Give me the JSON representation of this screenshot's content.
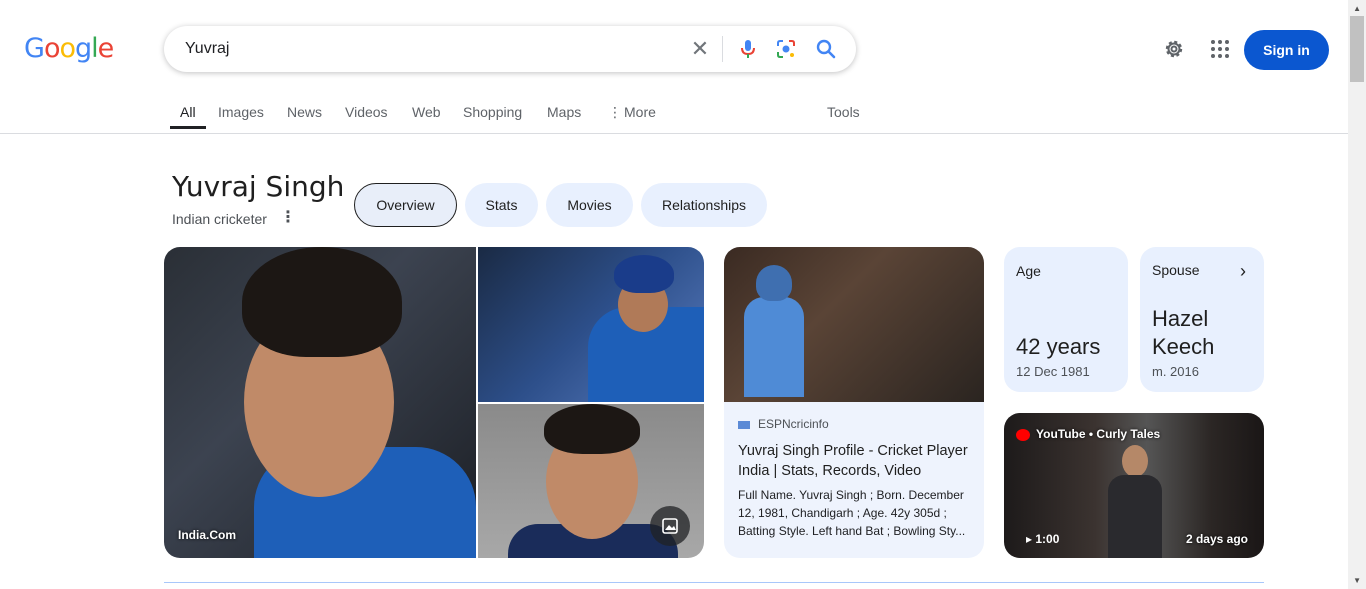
{
  "header": {
    "logo": [
      "G",
      "o",
      "o",
      "g",
      "l",
      "e"
    ],
    "logo_colors": [
      "#4285f4",
      "#ea4335",
      "#fbbc05",
      "#4285f4",
      "#34a853",
      "#ea4335"
    ],
    "search_value": "Yuvraj",
    "sign_in": "Sign in"
  },
  "nav": {
    "tabs": [
      "All",
      "Images",
      "News",
      "Videos",
      "Web",
      "Shopping",
      "Maps",
      "More"
    ],
    "tools": "Tools"
  },
  "entity": {
    "title": "Yuvraj Singh",
    "subtitle": "Indian cricketer",
    "chips": [
      "Overview",
      "Stats",
      "Movies",
      "Relationships"
    ]
  },
  "images": {
    "main_source": "India.Com"
  },
  "espn": {
    "source": "ESPNcricinfo",
    "title": "Yuvraj Singh Profile - Cricket Player India | Stats, Records, Video",
    "desc": "Full Name. Yuvraj Singh ; Born. December 12, 1981, Chandigarh ; Age. 42y 305d ; Batting Style. Left hand Bat ; Bowling Sty..."
  },
  "facts": {
    "age_label": "Age",
    "age_value": "42 years",
    "age_sub": "12 Dec 1981",
    "spouse_label": "Spouse",
    "spouse_value_1": "Hazel",
    "spouse_value_2": "Keech",
    "spouse_sub": "m. 2016"
  },
  "video": {
    "source": "YouTube • Curly Tales",
    "duration": "1:00",
    "date": "2 days ago"
  },
  "colors": {
    "accent": "#0b57d0",
    "chip_bg": "#e8f0fe"
  }
}
